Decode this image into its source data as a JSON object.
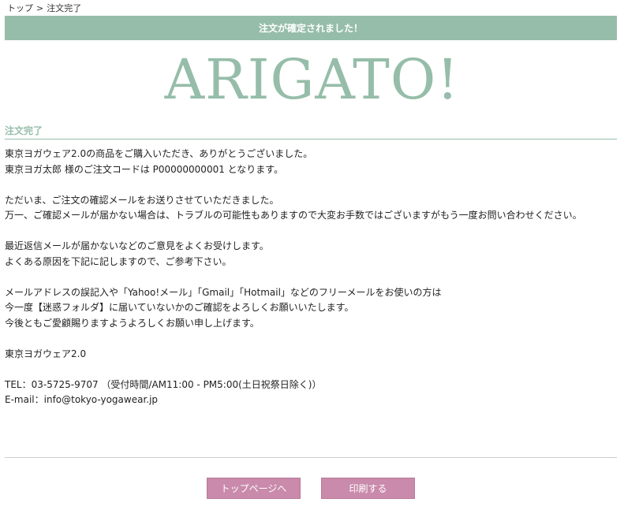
{
  "breadcrumb": {
    "home": "トップ",
    "separator": ">",
    "current": "注文完了"
  },
  "banner": {
    "text": "注文が確定されました！"
  },
  "hero": {
    "text": "ARIGATO!"
  },
  "section": {
    "title": "注文完了"
  },
  "message": {
    "lines": [
      "東京ヨガウェア2.0の商品をご購入いただき、ありがとうございました。",
      "東京ヨガ太郎 様のご注文コードは P00000000001 となります。",
      "",
      "ただいま、ご注文の確認メールをお送りさせていただきました。",
      "万一、ご確認メールが届かない場合は、トラブルの可能性もありますので大変お手数ではございますがもう一度お問い合わせください。",
      "",
      "最近返信メールが届かないなどのご意見をよくお受けします。",
      "よくある原因を下記に記しますので、ご参考下さい。",
      "",
      "メールアドレスの誤記入や「Yahoo!メール」「Gmail」「Hotmail」などのフリーメールをお使いの方は",
      "今一度【迷惑フォルダ】に届いていないかのご確認をよろしくお願いいたします。",
      "今後ともご愛顧賜りますようよろしくお願い申し上げます。",
      "",
      "東京ヨガウェア2.0",
      "",
      "TEL：03-5725-9707 （受付時間/AM11:00 - PM5:00(土日祝祭日除く)）",
      "E-mail：info@tokyo-yogawear.jp"
    ]
  },
  "buttons": {
    "top_page": "トップページへ",
    "print": "印刷する"
  },
  "colors": {
    "accent_green": "#96bda9",
    "button_pink": "#c98aab"
  }
}
